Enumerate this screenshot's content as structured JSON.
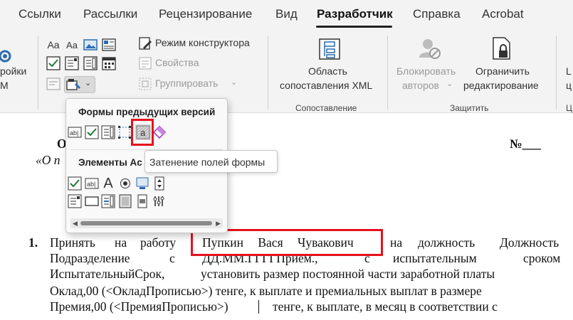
{
  "tabs": [
    {
      "label": "Ссылки"
    },
    {
      "label": "Рассылки"
    },
    {
      "label": "Рецензирование"
    },
    {
      "label": "Вид"
    },
    {
      "label": "Разработчик"
    },
    {
      "label": "Справка"
    },
    {
      "label": "Acrobat"
    }
  ],
  "ribbon": {
    "addins_line1": "ройки",
    "addins_line2": "M",
    "design_mode": "Режим конструктора",
    "properties": "Свойства",
    "group": "Группировать",
    "xml_mapping_line1": "Область",
    "xml_mapping_line2": "сопоставления XML",
    "block_authors_line1": "Блокировать",
    "block_authors_line2": "авторов",
    "restrict_editing_line1": "Ограничить",
    "restrict_editing_line2": "редактирование",
    "edge_line1": "L",
    "edge_line2": "ц",
    "group_mapping": "Сопоставление",
    "group_protect": "Защитить",
    "group_edge": "Ц"
  },
  "dropdown": {
    "legacy_title": "Формы предыдущих версий",
    "activex_title": "Элементы Ac",
    "tooltip": "Затенение полей формы"
  },
  "document": {
    "line1_left": "От «",
    "line1_right": "№___",
    "line2": "«О п",
    "item_number": "1.",
    "p1_a": "Принять",
    "p1_b": "на",
    "p1_c": "работу",
    "p1_name": "Пупкин Вася Чувакович",
    "p1_d": "на",
    "p1_e": "должность",
    "p1_f": "Должность",
    "p2_a": "Подразделение",
    "p2_b": "с",
    "p2_c": "ДД.ММ.ГГГГПрием.,",
    "p2_d": "с",
    "p2_e": "испытательным",
    "p2_f": "сроком",
    "p3_a": "ИспытательныйСрок,",
    "p3_b": "установить размер постоянной части заработной платы",
    "p4": "Оклад,00 (<ОкладПрописью>)  тенге, к выплате и премиальных выплат в размере",
    "p5_a": "Премия,00 (<ПремияПрописью>)",
    "p5_b": "тенге, к выплате,   в месяц в соответствии с"
  },
  "colors": {
    "accent_red": "#e6111b",
    "ribbon_bg": "#f3f3f3",
    "checkbox_green": "#1f7a3a"
  }
}
